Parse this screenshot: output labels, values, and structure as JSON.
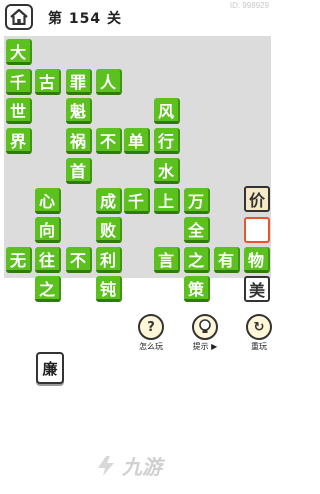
{
  "header": {
    "level": "第 154 关",
    "user_id": "ID: 998929"
  },
  "board_tiles": [
    "大",
    "千",
    "古",
    "罪",
    "人",
    "世",
    "魁",
    "风",
    "界",
    "祸",
    "不",
    "单",
    "行",
    "首",
    "水",
    "心",
    "成",
    "千",
    "上",
    "万",
    "向",
    "败",
    "全",
    "无",
    "往",
    "不",
    "利",
    "言",
    "之",
    "有",
    "物",
    "之",
    "钝",
    "策"
  ],
  "answer_blanks": [
    "价",
    "",
    "美"
  ],
  "tools": {
    "how_to_play": "怎么玩",
    "hint": "提示",
    "replay": "重玩"
  },
  "word_pool": [
    "廉"
  ],
  "watermark": "九游",
  "colors": {
    "tile_green": "#5cc01f",
    "board_bg": "#dcdcdc",
    "candidate_bg": "#f6e9c8",
    "selected_border": "#e5572a"
  }
}
